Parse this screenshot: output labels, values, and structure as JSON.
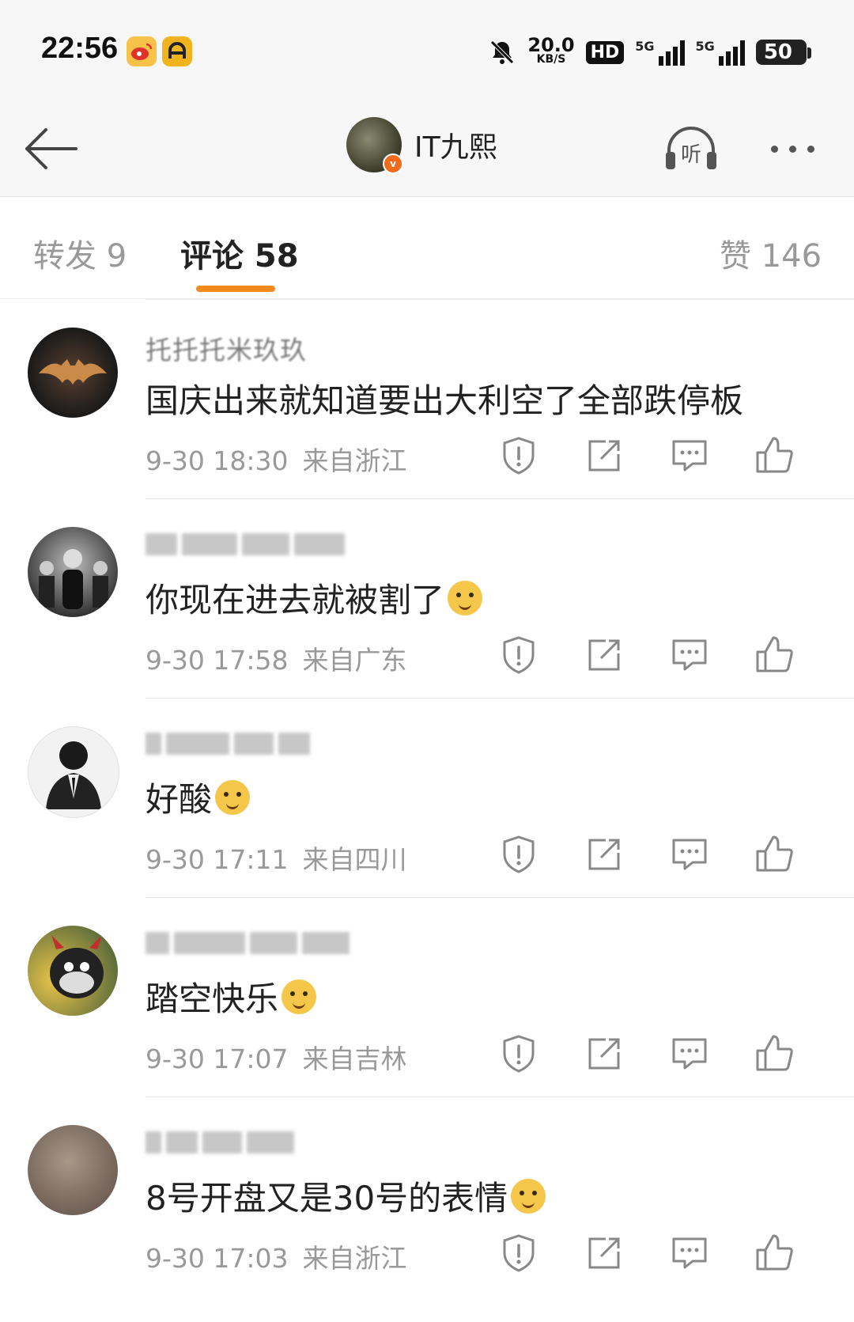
{
  "status_bar": {
    "time": "22:56",
    "net_speed_value": "20.0",
    "net_speed_unit": "KB/S",
    "hd_label": "HD",
    "sig1_label": "5G",
    "sig2_label": "5G",
    "battery": "50"
  },
  "nav": {
    "title": "IT九熙",
    "listen_label": "听"
  },
  "tabs": {
    "repost": "转发 9",
    "comment": "评论 58",
    "like": "赞 146"
  },
  "comments": [
    {
      "name": "托托托米玖玖",
      "text": "国庆出来就知道要出大利空了全部跌停板",
      "emoji": false,
      "time": "9-30 18:30",
      "location": "来自浙江"
    },
    {
      "name": "",
      "text": "你现在进去就被割了",
      "emoji": true,
      "time": "9-30 17:58",
      "location": "来自广东"
    },
    {
      "name": "",
      "text": "好酸",
      "emoji": true,
      "time": "9-30 17:11",
      "location": "来自四川"
    },
    {
      "name": "",
      "text": "踏空快乐",
      "emoji": true,
      "time": "9-30 17:07",
      "location": "来自吉林"
    },
    {
      "name": "",
      "text": "8号开盘又是30号的表情",
      "emoji": true,
      "time": "9-30 17:03",
      "location": "来自浙江"
    }
  ],
  "colors": {
    "accent": "#f28a1d",
    "verified_badge": "#f26b1d"
  },
  "icons": [
    "back-arrow-icon",
    "listen-icon",
    "more-icon",
    "report-icon",
    "share-icon",
    "reply-icon",
    "like-icon"
  ]
}
